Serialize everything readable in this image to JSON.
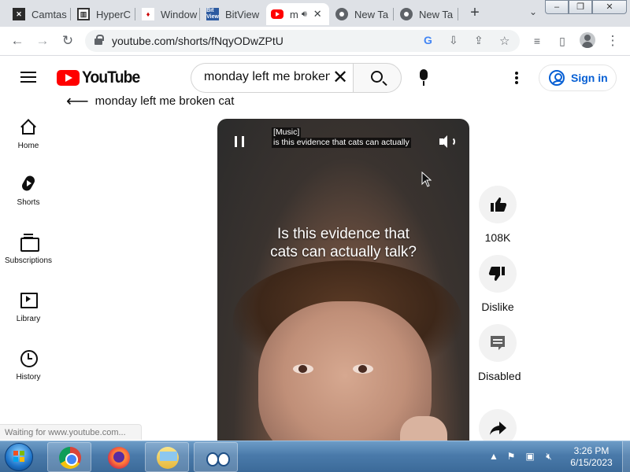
{
  "browser": {
    "tabs": [
      {
        "title": "Camtas",
        "favicon": "camtasia-icon"
      },
      {
        "title": "HyperC",
        "favicon": "hypercam-icon"
      },
      {
        "title": "Window",
        "favicon": "window-icon"
      },
      {
        "title": "BitView",
        "favicon": "bitview-icon"
      },
      {
        "title": "m",
        "favicon": "youtube-icon",
        "active": true
      },
      {
        "title": "New Ta",
        "favicon": "chrome-icon"
      },
      {
        "title": "New Ta",
        "favicon": "chrome-icon"
      }
    ],
    "new_tab": "+",
    "url": "youtube.com/shorts/fNqyODwZPtU",
    "window_controls": [
      "–",
      "❐",
      "✕"
    ]
  },
  "youtube": {
    "logo_text": "YouTube",
    "search": {
      "value": "monday left me broken cat",
      "placeholder": "Search"
    },
    "signin_label": "Sign in",
    "suggestion": "monday left me broken cat",
    "nav": [
      {
        "label": "Home",
        "icon": "home-icon"
      },
      {
        "label": "Shorts",
        "icon": "shorts-icon"
      },
      {
        "label": "Subscriptions",
        "icon": "subscriptions-icon"
      },
      {
        "label": "Library",
        "icon": "library-icon"
      },
      {
        "label": "History",
        "icon": "history-icon"
      }
    ],
    "player": {
      "caption_line1": "[Music]",
      "caption_line2": "is this evidence that cats can actually",
      "overlay_line1": "Is this evidence that",
      "overlay_line2": "cats can actually talk?"
    },
    "actions": {
      "like_count": "108K",
      "dislike_label": "Dislike",
      "comments_label": "Disabled",
      "share_label": ""
    },
    "status_text": "Waiting for www.youtube.com..."
  },
  "taskbar": {
    "apps": [
      "chrome",
      "firefox",
      "explorer",
      "eyes"
    ],
    "clock_time": "3:26 PM",
    "clock_date": "6/15/2023"
  },
  "colors": {
    "youtube_red": "#ff0000",
    "signin_blue": "#065fd4",
    "tabstrip": "#dee1e6",
    "taskbar": "#4a7aaa"
  }
}
